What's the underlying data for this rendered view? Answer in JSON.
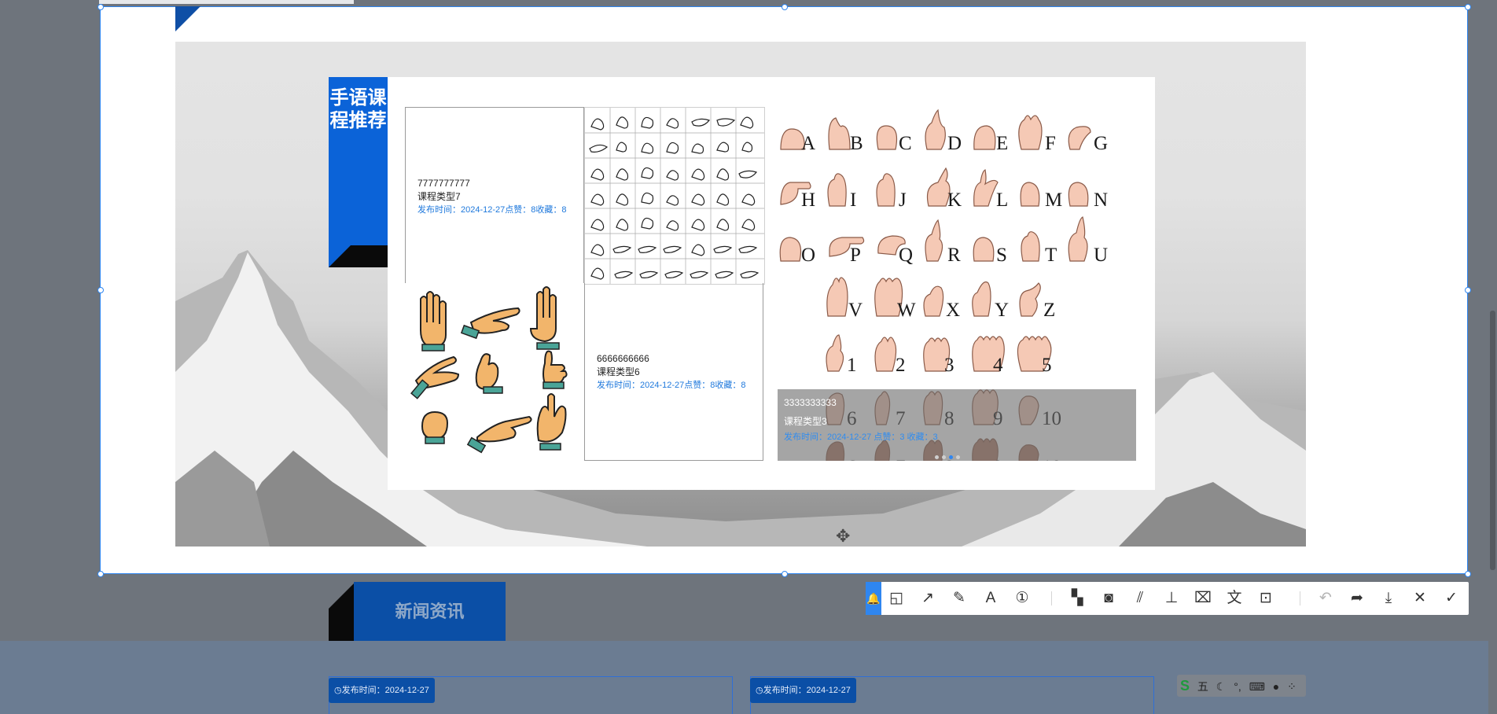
{
  "banner": {
    "section_title": "手语课程推荐"
  },
  "courses": [
    {
      "title": "7777777777",
      "type": "课程类型7",
      "meta": "发布时间：2024-12-27点赞：8收藏：8"
    },
    {
      "title": "6666666666",
      "type": "课程类型6",
      "meta": "发布时间：2024-12-27点赞：8收藏：8"
    },
    {
      "title": "3333333333",
      "type": "课程类型3",
      "meta": "发布时间：2024-12-27  点赞：3  收藏：3"
    }
  ],
  "alphabet_letters": [
    "A",
    "B",
    "C",
    "D",
    "E",
    "F",
    "G",
    "H",
    "I",
    "J",
    "K",
    "L",
    "M",
    "N",
    "O",
    "P",
    "Q",
    "R",
    "S",
    "T",
    "U",
    "V",
    "W",
    "X",
    "Y",
    "Z"
  ],
  "alphabet_numbers": [
    "1",
    "2",
    "3",
    "4",
    "5",
    "6",
    "7",
    "8",
    "9",
    "10"
  ],
  "carousel": {
    "count": 3,
    "active": 2
  },
  "news_section": {
    "title": "新闻资讯"
  },
  "news_cards": [
    {
      "date": "发布时间：2024-12-27"
    },
    {
      "date": "发布时间：2024-12-27"
    }
  ],
  "toolbar": {
    "tools": [
      {
        "name": "shape-tool",
        "icon": "shapes-icon",
        "glyph": "◱"
      },
      {
        "name": "arrow-tool",
        "icon": "arrow-icon",
        "glyph": "↗"
      },
      {
        "name": "pen-tool",
        "icon": "pen-icon",
        "glyph": "✎"
      },
      {
        "name": "text-tool",
        "icon": "text-icon",
        "glyph": "A"
      },
      {
        "name": "number-tool",
        "icon": "numbered-marker-icon",
        "glyph": "①"
      },
      {
        "name": "mosaic-tool",
        "icon": "mosaic-icon",
        "glyph": "▚"
      },
      {
        "name": "blur-tool",
        "icon": "blur-icon",
        "glyph": "◙"
      },
      {
        "name": "hatch-tool",
        "icon": "hatch-icon",
        "glyph": "⫽"
      },
      {
        "name": "pin-tool",
        "icon": "pin-icon",
        "glyph": "⊥"
      },
      {
        "name": "ocr-tool",
        "icon": "ocr-icon",
        "glyph": "⌧"
      },
      {
        "name": "translate-tool",
        "icon": "translate-icon",
        "glyph": "文"
      },
      {
        "name": "extract-text-tool",
        "icon": "extract-text-icon",
        "glyph": "⊡"
      },
      {
        "name": "undo-button",
        "icon": "undo-icon",
        "glyph": "↶"
      },
      {
        "name": "share-button",
        "icon": "share-icon",
        "glyph": "➦"
      },
      {
        "name": "download-button",
        "icon": "download-icon",
        "glyph": "⤓"
      },
      {
        "name": "close-button",
        "icon": "close-icon",
        "glyph": "✕"
      },
      {
        "name": "confirm-button",
        "icon": "check-icon",
        "glyph": "✓"
      }
    ]
  },
  "ime_bar": {
    "mode": "五"
  },
  "colors": {
    "accent": "#0b63d8",
    "selection": "#2f86f0",
    "meta": "#1e78dc"
  }
}
